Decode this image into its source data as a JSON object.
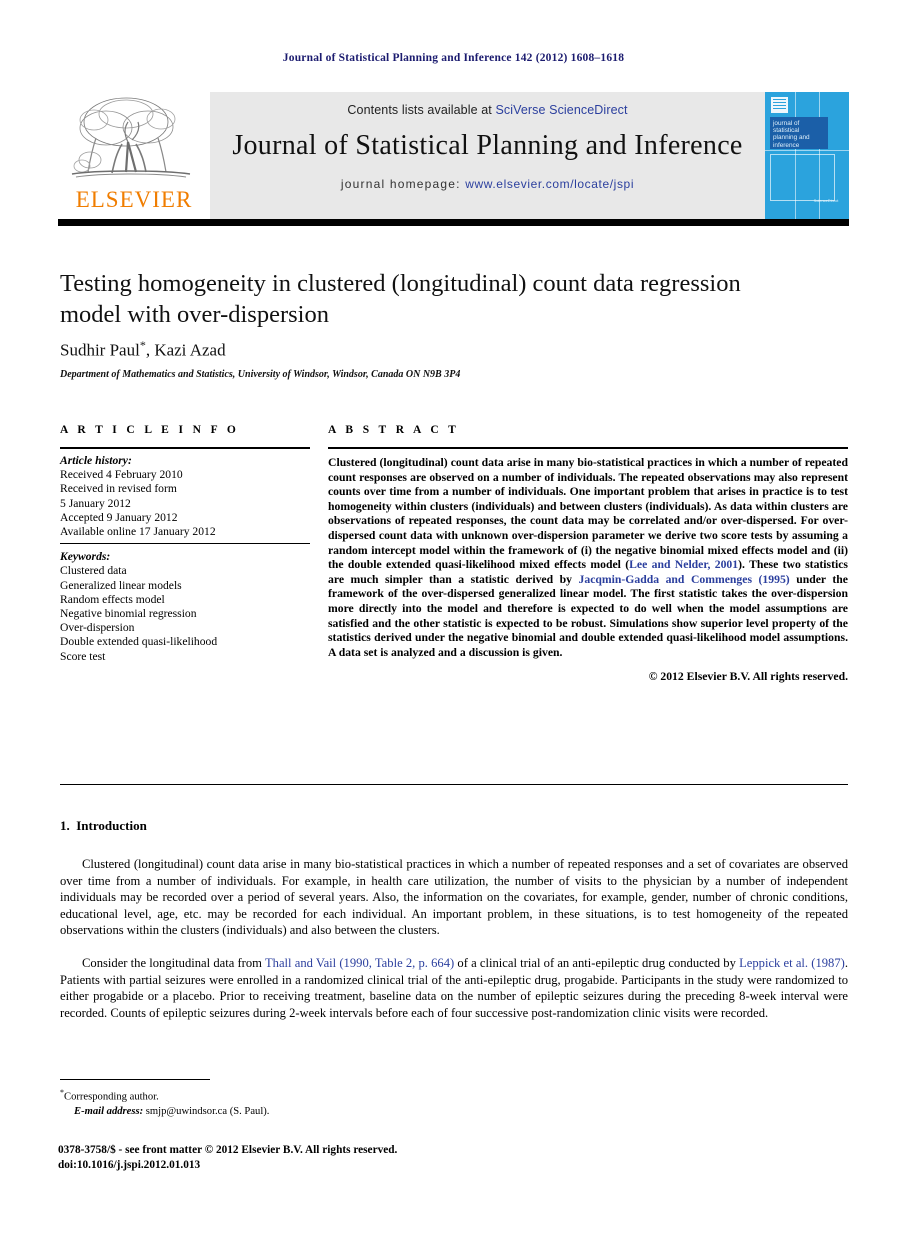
{
  "running_head": "Journal of Statistical Planning and Inference 142 (2012) 1608–1618",
  "masthead": {
    "contents_prefix": "Contents lists available at ",
    "sciencedirect": "SciVerse ScienceDirect",
    "journal_name": "Journal of Statistical Planning and Inference",
    "homepage_prefix": "journal homepage: ",
    "homepage_url": "www.elsevier.com/locate/jspi",
    "publisher_wordmark": "ELSEVIER",
    "cover_title": "journal of statistical planning and inference",
    "cover_footer": "ScienceDirect"
  },
  "article": {
    "title": "Testing homogeneity in clustered (longitudinal) count data regression model with over-dispersion",
    "authors": "Sudhir Paul",
    "authors_second": ", Kazi Azad",
    "corresponding_mark": "*",
    "affiliation": "Department of Mathematics and Statistics, University of Windsor, Windsor, Canada ON N9B 3P4"
  },
  "article_info": {
    "heading": "A R T I C L E   I N F O",
    "history_label": "Article history:",
    "history": [
      "Received 4 February 2010",
      "Received in revised form",
      "5 January 2012",
      "Accepted 9 January 2012",
      "Available online 17 January 2012"
    ],
    "keywords_label": "Keywords:",
    "keywords": [
      "Clustered data",
      "Generalized linear models",
      "Random effects model",
      "Negative binomial regression",
      "Over-dispersion",
      "Double extended quasi-likelihood",
      "Score test"
    ]
  },
  "abstract": {
    "heading": "A B S T R A C T",
    "part1": "Clustered (longitudinal) count data arise in many bio-statistical practices in which a number of repeated count responses are observed on a number of individuals. The repeated observations may also represent counts over time from a number of individuals. One important problem that arises in practice is to test homogeneity within clusters (individuals) and between clusters (individuals). As data within clusters are observations of repeated responses, the count data may be correlated and/or over-dispersed. For over-dispersed count data with unknown over-dispersion parameter we derive two score tests by assuming a random intercept model within the framework of (i) the negative binomial mixed effects model and (ii) the double extended quasi-likelihood mixed effects model (",
    "cite1": "Lee and Nelder, 2001",
    "part2": "). These two statistics are much simpler than a statistic derived by ",
    "cite2": "Jacqmin-Gadda and Commenges (1995)",
    "part3": " under the framework of the over-dispersed generalized linear model. The first statistic takes the over-dispersion more directly into the model and therefore is expected to do well when the model assumptions are satisfied and the other statistic is expected to be robust. Simulations show superior level property of the statistics derived under the negative binomial and double extended quasi-likelihood model assumptions. A data set is analyzed and a discussion is given.",
    "copyright": "© 2012 Elsevier B.V. All rights reserved."
  },
  "introduction": {
    "number": "1.",
    "heading": "Introduction",
    "para1": "Clustered (longitudinal) count data arise in many bio-statistical practices in which a number of repeated responses and a set of covariates are observed over time from a number of individuals. For example, in health care utilization, the number of visits to the physician by a number of independent individuals may be recorded over a period of several years. Also, the information on the covariates, for example, gender, number of chronic conditions, educational level, age, etc. may be recorded for each individual. An important problem, in these situations, is to test homogeneity of the repeated observations within the clusters (individuals) and also between the clusters.",
    "para2_a": "Consider the longitudinal data from ",
    "para2_cite1": "Thall and Vail (1990, Table 2, p. 664)",
    "para2_b": " of a clinical trial of an anti-epileptic drug conducted by ",
    "para2_cite2": "Leppick et al. (1987)",
    "para2_c": ". Patients with partial seizures were enrolled in a randomized clinical trial of the anti-epileptic drug, progabide. Participants in the study were randomized to either progabide or a placebo. Prior to receiving treatment, baseline data on the number of epileptic seizures during the preceding 8-week interval were recorded. Counts of epileptic seizures during 2-week intervals before each of four successive post-randomization clinic visits were recorded."
  },
  "footnotes": {
    "corresponding_mark": "*",
    "corresponding": "Corresponding author.",
    "email_label": "E-mail address:",
    "email": " smjp@uwindsor.ca (S. Paul).",
    "issn_line": "0378-3758/$ - see front matter © 2012 Elsevier B.V. All rights reserved.",
    "doi_line": "doi:10.1016/j.jspi.2012.01.013"
  },
  "colors": {
    "link_blue": "#2b3f9e",
    "running_head_navy": "#1b1b6f",
    "elsevier_orange": "#f07d00",
    "cover_blue": "#2ba3dd",
    "masthead_gray": "#e8e8e8"
  }
}
